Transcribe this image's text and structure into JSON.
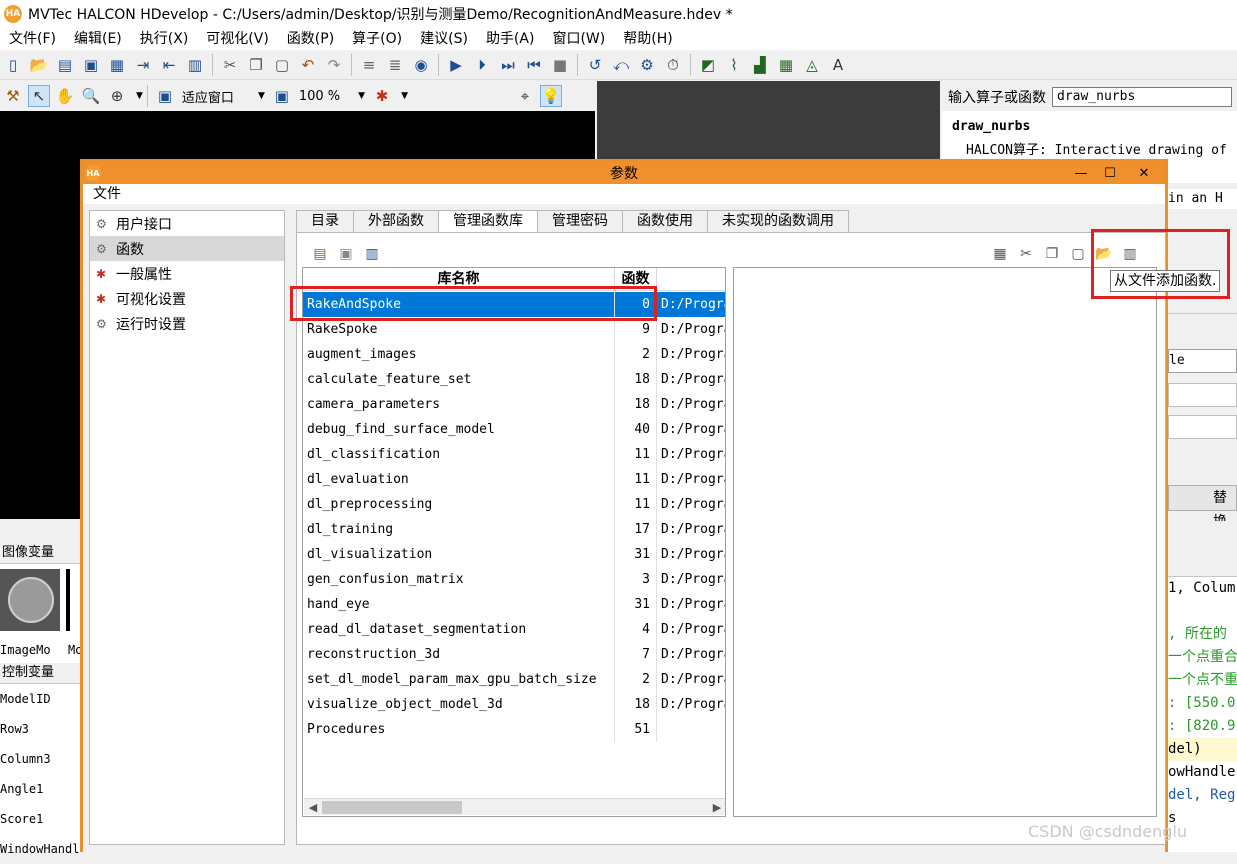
{
  "window": {
    "title": "MVTec HALCON HDevelop - C:/Users/admin/Desktop/识别与测量Demo/RecognitionAndMeasure.hdev *",
    "logo": "HA"
  },
  "menu": [
    "文件(F)",
    "编辑(E)",
    "执行(X)",
    "可视化(V)",
    "函数(P)",
    "算子(O)",
    "建议(S)",
    "助手(A)",
    "窗口(W)",
    "帮助(H)"
  ],
  "toolbar2": {
    "fit_window": "适应窗口",
    "zoom": "100 %"
  },
  "help_panel": {
    "search_label": "输入算子或函数",
    "search_value": "draw_nurbs",
    "op_name": "draw_nurbs",
    "op_desc": "HALCON算子: Interactive drawing of"
  },
  "image_vars": {
    "header": "图像变量",
    "items": [
      "ImageMo",
      "Mo"
    ]
  },
  "ctrl_vars": {
    "header": "控制变量",
    "items": [
      "ModelID",
      "Row3",
      "Column3",
      "Angle1",
      "Score1",
      "WindowHandl"
    ]
  },
  "side_strip": {
    "fragments": [
      "in an H",
      "le",
      "替换"
    ]
  },
  "editor": {
    "lines": [
      "1, Colum",
      "",
      ", 所在的",
      "一个点重合",
      "一个点不重",
      ": [550.0",
      ": [820.9",
      "del)",
      "owHandle",
      "del, Reg",
      "s"
    ]
  },
  "dialog": {
    "title": "参数",
    "menu": "文件",
    "nav": [
      {
        "label": "用户接口",
        "icon": "wrench-icon"
      },
      {
        "label": "函数",
        "icon": "gear-icon"
      },
      {
        "label": "一般属性",
        "icon": "wrench-icon"
      },
      {
        "label": "可视化设置",
        "icon": "wrench-icon"
      },
      {
        "label": "运行时设置",
        "icon": "gear-icon"
      }
    ],
    "tabs": [
      "目录",
      "外部函数",
      "管理函数库",
      "管理密码",
      "函数使用",
      "未实现的函数调用"
    ],
    "active_tab": 2,
    "table": {
      "headers": [
        "库名称",
        "函数"
      ],
      "rows": [
        {
          "name": "RakeAndSpoke",
          "count": "0",
          "path": "D:/Progra"
        },
        {
          "name": "RakeSpoke",
          "count": "9",
          "path": "D:/Progra"
        },
        {
          "name": "augment_images",
          "count": "2",
          "path": "D:/Progra"
        },
        {
          "name": "calculate_feature_set",
          "count": "18",
          "path": "D:/Progra"
        },
        {
          "name": "camera_parameters",
          "count": "18",
          "path": "D:/Progra"
        },
        {
          "name": "debug_find_surface_model",
          "count": "40",
          "path": "D:/Progra"
        },
        {
          "name": "dl_classification",
          "count": "11",
          "path": "D:/Progra"
        },
        {
          "name": "dl_evaluation",
          "count": "11",
          "path": "D:/Progra"
        },
        {
          "name": "dl_preprocessing",
          "count": "11",
          "path": "D:/Progra"
        },
        {
          "name": "dl_training",
          "count": "17",
          "path": "D:/Progra"
        },
        {
          "name": "dl_visualization",
          "count": "31",
          "path": "D:/Progra"
        },
        {
          "name": "gen_confusion_matrix",
          "count": "3",
          "path": "D:/Progra"
        },
        {
          "name": "hand_eye",
          "count": "31",
          "path": "D:/Progra"
        },
        {
          "name": "read_dl_dataset_segmentation",
          "count": "4",
          "path": "D:/Progra"
        },
        {
          "name": "reconstruction_3d",
          "count": "7",
          "path": "D:/Progra"
        },
        {
          "name": "set_dl_model_param_max_gpu_batch_size",
          "count": "2",
          "path": "D:/Progra"
        },
        {
          "name": "visualize_object_model_3d",
          "count": "18",
          "path": "D:/Progra"
        },
        {
          "name": "Procedures",
          "count": "51",
          "path": ""
        }
      ],
      "selected_row": 0
    },
    "tooltip": "从文件添加函数."
  },
  "watermark": "CSDN @csdndenglu",
  "colors": {
    "dialog_accent": "#f0902c",
    "selection": "#0078d7",
    "highlight_box": "#e02020"
  }
}
